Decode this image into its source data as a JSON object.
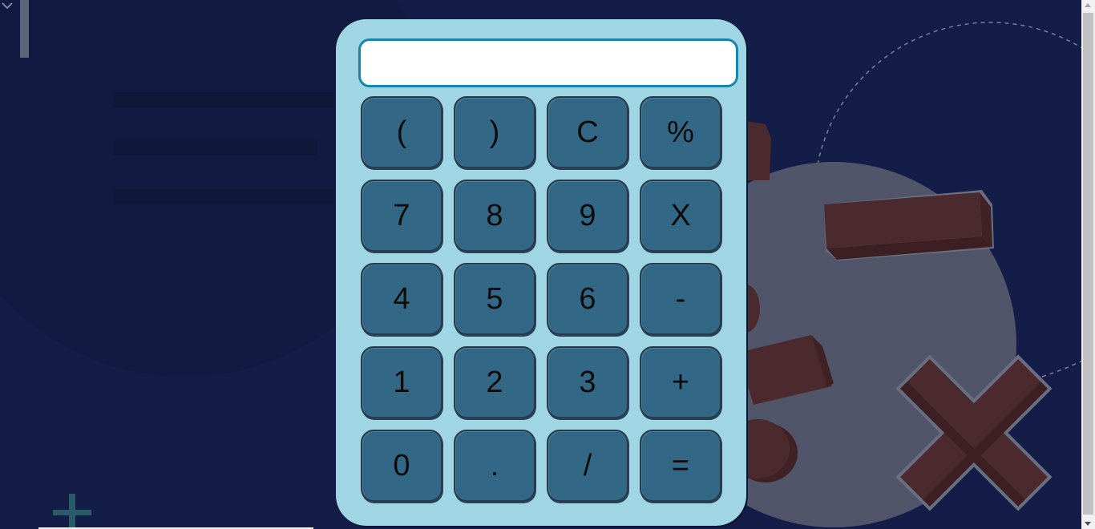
{
  "calculator": {
    "display_value": "",
    "keys": [
      "(",
      ")",
      "C",
      "%",
      "7",
      "8",
      "9",
      "X",
      "4",
      "5",
      "6",
      "-",
      "1",
      "2",
      "3",
      "+",
      "0",
      ".",
      "/",
      "="
    ]
  },
  "colors": {
    "page_background": "#131d48",
    "calculator_body": "#a0d6e4",
    "display_border": "#1687a8",
    "key_fill": "#326886",
    "decor_shape": "#4b2a2e"
  }
}
